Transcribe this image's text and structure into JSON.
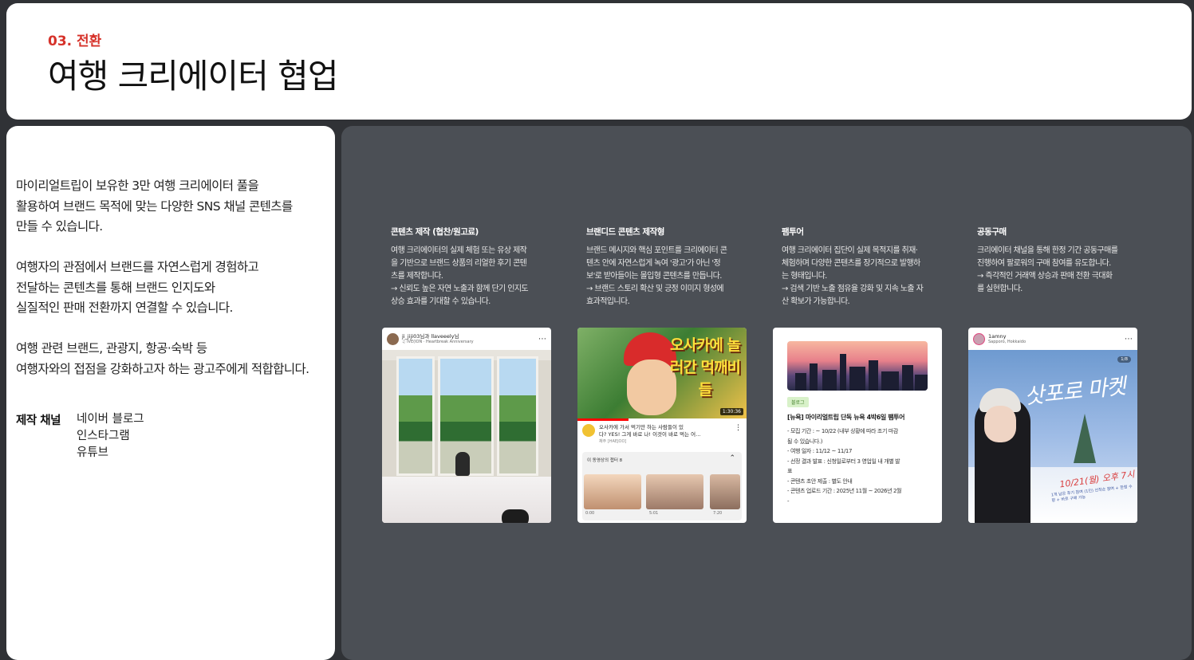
{
  "header": {
    "section": "03. 전환",
    "title": "여행 크리에이터 협업"
  },
  "intro": {
    "p1": [
      "마이리얼트립이 보유한 3만 여행 크리에이터 풀을",
      "활용하여 브랜드 목적에 맞는 다양한 SNS 채널 콘텐츠를",
      "만들 수 있습니다."
    ],
    "p2": [
      "여행자의 관점에서 브랜드를 자연스럽게 경험하고",
      "전달하는 콘텐츠를 통해 브랜드 인지도와",
      "실질적인 판매 전환까지 연결할 수 있습니다."
    ],
    "p3": [
      "여행 관련 브랜드, 관광지, 항공·숙박 등",
      "여행자와의 접점을 강화하고자 하는 광고주에게 적합합니다."
    ],
    "channel_label": "제작 채널",
    "channels": [
      "네이버 블로그",
      "인스타그램",
      "유튜브"
    ]
  },
  "columns": [
    {
      "title": "콘텐츠 제작 (협찬/원고료)",
      "desc": [
        "여행 크리에이터의 실제 체험 또는 유상 제작",
        "을 기반으로 브랜드 상품의 리얼한 후기 콘텐",
        "츠를 제작합니다.",
        "→ 신뢰도 높은 자연 노출과 함께 단기 인지도",
        "상승 효과를 기대할 수 있습니다."
      ]
    },
    {
      "title": "브랜디드 콘텐츠 제작형",
      "desc": [
        "브랜드 메시지와 핵심 포인트를 크리에이터 콘",
        "텐츠 안에 자연스럽게 녹여 '광고'가 아닌 '정",
        "보'로 받아들이는 몰입형 콘텐츠를 만듭니다.",
        "→ 브랜드 스토리 확산 및 긍정 이미지 형성에",
        "효과적입니다."
      ]
    },
    {
      "title": "팸투어",
      "desc": [
        "여행 크리에이터 집단이 실제 목적지를 취재·",
        "체험하며 다양한 콘텐츠를 장기적으로 발행하",
        "는 형태입니다.",
        "→ 검색 기반 노출 점유율 강화 및 지속 노출 자",
        "산 확보가 가능합니다."
      ]
    },
    {
      "title": "공동구매",
      "desc": [
        "크리에이터 채널을 통해 한정 기간 공동구매를",
        "진행하여 팔로워의 구매 참여를 유도합니다.",
        "→ 즉각적인 거래액 상승과 판매 전환 극대화",
        "를 실현합니다."
      ]
    }
  ],
  "card1": {
    "user": "ji_jiji03님과 llaveeely님",
    "music": "♫ IVE(ION · Heartbreak Anniversary"
  },
  "card2": {
    "thumb_text": "오사카에 놀러간 먹깨비들",
    "duration": "1:30:36",
    "title_line1": "오사카에 가서 먹기만 하는 사람들이 있",
    "title_line2": "다? YES! 그게 바로 나! 이것이 바로 먹는 어…",
    "channel": "채주 [HAEJOO]",
    "list_title": "이 동영상의 챕터 8",
    "times": [
      "0:00",
      "5:01",
      "7:20"
    ]
  },
  "card3": {
    "tag": "블로그",
    "title": "[뉴욕] 마이리얼트립 단독 뉴욕 4박6일 팸투어",
    "lines": [
      "- 모집 기간 : ~ 10/22 (내부 상황에 따라 조기 마감",
      "될 수 있습니다.)",
      "- 여행 일자 : 11/12 ~ 11/17",
      "- 선정 결과 발표 : 신청일로부터 3 영업일 내 개별 발",
      "표",
      "- 콘텐츠 초안 제출 : 별도 안내",
      "- 콘텐츠 업로드 기간 : 2025년 11월 ~ 2026년 2월",
      "-"
    ]
  },
  "card4": {
    "user": "1amny",
    "location": "Sapporo, Hokkaido",
    "count": "1/8",
    "script": "삿포로 마켓",
    "date": "10/21(월) 오후 7시",
    "note": "1개 남은 후기 참여 (1인) 선착순 참여 + 한정 수량 + 바로 구매 가능"
  }
}
